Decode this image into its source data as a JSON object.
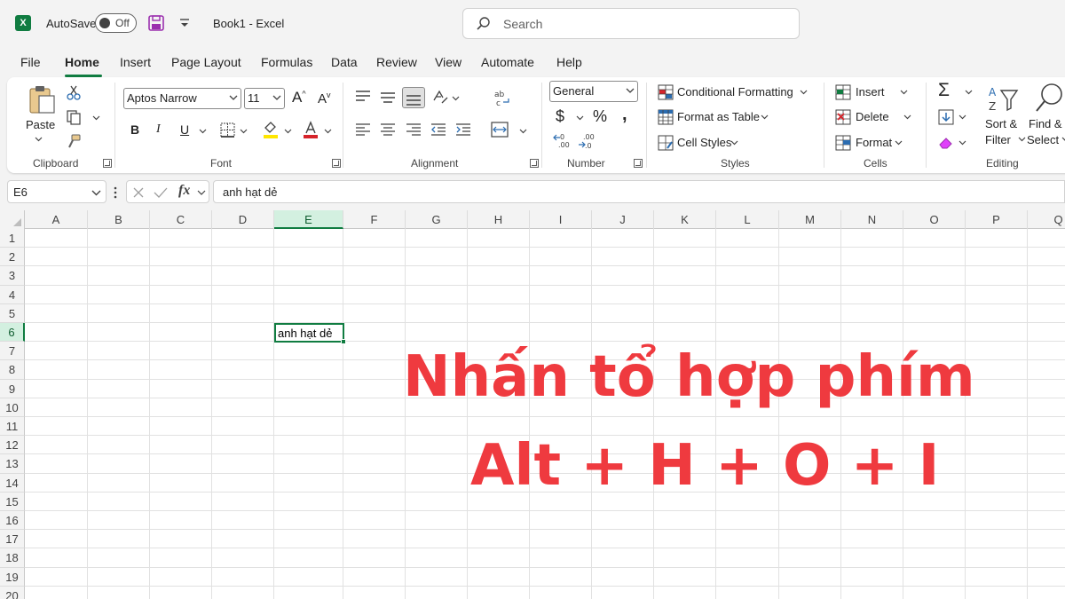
{
  "titlebar": {
    "app_icon": "excel-logo-icon",
    "app_icon_letter": "X",
    "autosave_label": "AutoSave",
    "autosave_state": "Off",
    "document_title": "Book1  -  Excel",
    "search_placeholder": "Search"
  },
  "menu": {
    "tabs": [
      "File",
      "Home",
      "Insert",
      "Page Layout",
      "Formulas",
      "Data",
      "Review",
      "View",
      "Automate",
      "Help"
    ],
    "active_tab": "Home"
  },
  "ribbon": {
    "clipboard": {
      "paste_label": "Paste",
      "group_label": "Clipboard"
    },
    "font": {
      "font_name": "Aptos Narrow",
      "font_size": "11",
      "bold": "B",
      "italic": "I",
      "underline": "U",
      "group_label": "Font"
    },
    "alignment": {
      "group_label": "Alignment"
    },
    "number": {
      "format": "General",
      "currency": "$",
      "percent": "%",
      "comma": ",",
      "group_label": "Number"
    },
    "styles": {
      "conditional_formatting": "Conditional Formatting",
      "format_as_table": "Format as Table",
      "cell_styles": "Cell Styles",
      "group_label": "Styles"
    },
    "cells": {
      "insert": "Insert",
      "delete": "Delete",
      "format": "Format",
      "group_label": "Cells"
    },
    "editing": {
      "sort_filter_1": "Sort &",
      "sort_filter_2": "Filter",
      "find_select_1": "Find &",
      "find_select_2": "Select",
      "group_label": "Editing"
    }
  },
  "formula_bar": {
    "name_box": "E6",
    "fx": "fx",
    "content": "anh hạt dẻ"
  },
  "grid": {
    "columns": [
      "A",
      "B",
      "C",
      "D",
      "E",
      "F",
      "G",
      "H",
      "I",
      "J",
      "K",
      "L",
      "M",
      "N",
      "O",
      "P",
      "Q"
    ],
    "rows": [
      "1",
      "2",
      "3",
      "4",
      "5",
      "6",
      "7",
      "8",
      "9",
      "10",
      "11",
      "12",
      "13",
      "14",
      "15",
      "16",
      "17",
      "18",
      "19",
      "20"
    ],
    "selected_column": "E",
    "selected_row": "6",
    "active_cell_value": "anh hạt dẻ"
  },
  "overlay": {
    "line1": "Nhấn tổ hợp phím",
    "line2": "Alt + H + O + I",
    "color": "#ef3a3f"
  },
  "colors": {
    "accent": "#107c41"
  }
}
